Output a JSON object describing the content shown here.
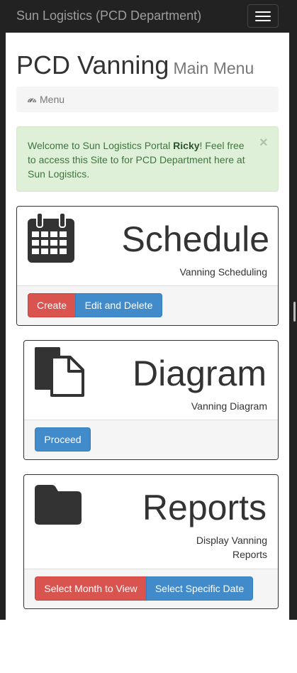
{
  "navbar": {
    "brand": "Sun Logistics (PCD Department)",
    "toggle_icon": "hamburger-menu-icon"
  },
  "page": {
    "title": "PCD Vanning",
    "subtitle": "Main Menu"
  },
  "breadcrumb": {
    "icon": "dashboard-icon",
    "label": "Menu"
  },
  "alert": {
    "prefix": "Welcome to Sun Logistics Portal ",
    "user": "Ricky",
    "suffix": "! Feel free to access this Site to for PCD Department here at Sun Logistics.",
    "close_label": "×"
  },
  "panels": {
    "schedule": {
      "icon": "calendar-icon",
      "heading": "Schedule",
      "description": "Vanning Scheduling",
      "buttons": {
        "create": "Create",
        "edit_delete": "Edit and Delete"
      }
    },
    "diagram": {
      "icon": "documents-icon",
      "heading": "Diagram",
      "description": "Vanning Diagram",
      "buttons": {
        "proceed": "Proceed"
      }
    },
    "reports": {
      "icon": "folder-icon",
      "heading": "Reports",
      "description_line1": "Display Vanning",
      "description_line2": "Reports",
      "buttons": {
        "select_month": "Select Month to View",
        "select_date": "Select Specific Date"
      }
    }
  },
  "colors": {
    "navbar": "#222222",
    "danger": "#d9534f",
    "primary": "#428bca",
    "success_bg": "#dff0d8",
    "success_text": "#3c763d"
  }
}
